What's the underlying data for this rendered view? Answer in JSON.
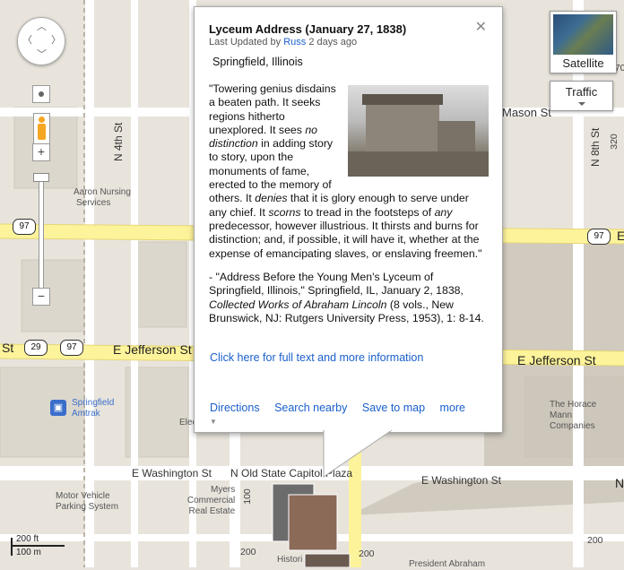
{
  "map": {
    "labels": {
      "n4th": "N 4th St",
      "n8th": "N 8th St",
      "mason": "Mason St",
      "jeff_w": "E Jefferson St",
      "jeff_e": "E Jefferson St",
      "st_left": "St",
      "wash_w": "E Washington St",
      "wash_e": "E Washington St",
      "old_capitol": "N Old State Capitol Plaza",
      "e_edge": "E",
      "n1_edge": "N",
      "route320": "320",
      "r170": "170",
      "r200": "200",
      "r100": "100",
      "r200b": "200",
      "r200c": "200"
    },
    "shields": {
      "s97_left": "97",
      "s97_right": "97",
      "s29": "29",
      "s97_mid": "97"
    },
    "pois": {
      "aaron_1": "Aaron Nursing",
      "aaron_2": "Services",
      "amtrak_1": "Springfield",
      "amtrak_2": "Amtrak",
      "horace_1": "The Horace",
      "horace_2": "Mann",
      "horace_3": "Companies",
      "elec": "Elec",
      "mvps_1": "Motor Vehicle",
      "mvps_2": "Parking System",
      "myers_1": "Myers",
      "myers_2": "Commercial",
      "myers_3": "Real Estate",
      "histori": "Histori",
      "president": "President Abraham"
    }
  },
  "controls": {
    "satellite": "Satellite",
    "traffic": "Traffic",
    "zoom_in": "+",
    "zoom_out": "−",
    "scale_ft": "200 ft",
    "scale_m": "100 m"
  },
  "info_window": {
    "title": "Lyceum Address (January 27, 1838)",
    "updated_prefix": "Last Updated by",
    "updated_user": "Russ",
    "updated_suffix": "2 days ago",
    "place": "Springfield, Illinois",
    "quote": {
      "p1": "\"Towering genius disdains a beaten path. It seeks regions hitherto unexplored. It sees ",
      "em1": "no distinction",
      "p2": " in adding story to story, upon the monuments of fame, erected to the memory of others. It ",
      "em2": "denies",
      "p3": " that it is glory enough to serve under any chief. It ",
      "em3": "scorns",
      "p4": " to tread in the footsteps of ",
      "em4": "any",
      "p5": " predecessor, however illustrious. It thirsts and burns for distinction; and, if possible, it will have it, whether at the expense of emancipating slaves, or enslaving freemen.\""
    },
    "cite": {
      "p1": " - \"Address Before the Young Men's Lyceum of Springfield, Illinois,\" Springfield, IL, January 2, 1838, ",
      "em": "Collected Works of Abraham Lincoln",
      "p2": " (8 vols., New Brunswick, NJ: Rutgers University Press, 1953), 1: 8-14."
    },
    "full_text_link": "Click here for full text and more information",
    "actions": {
      "directions": "Directions",
      "search_nearby": "Search nearby",
      "save_to_map": "Save to map",
      "more": "more"
    }
  },
  "colors": {
    "link": "#1a5fcc",
    "road_major": "#fdf39a",
    "road_minor": "#ffffff",
    "land": "#e8e4dc"
  }
}
